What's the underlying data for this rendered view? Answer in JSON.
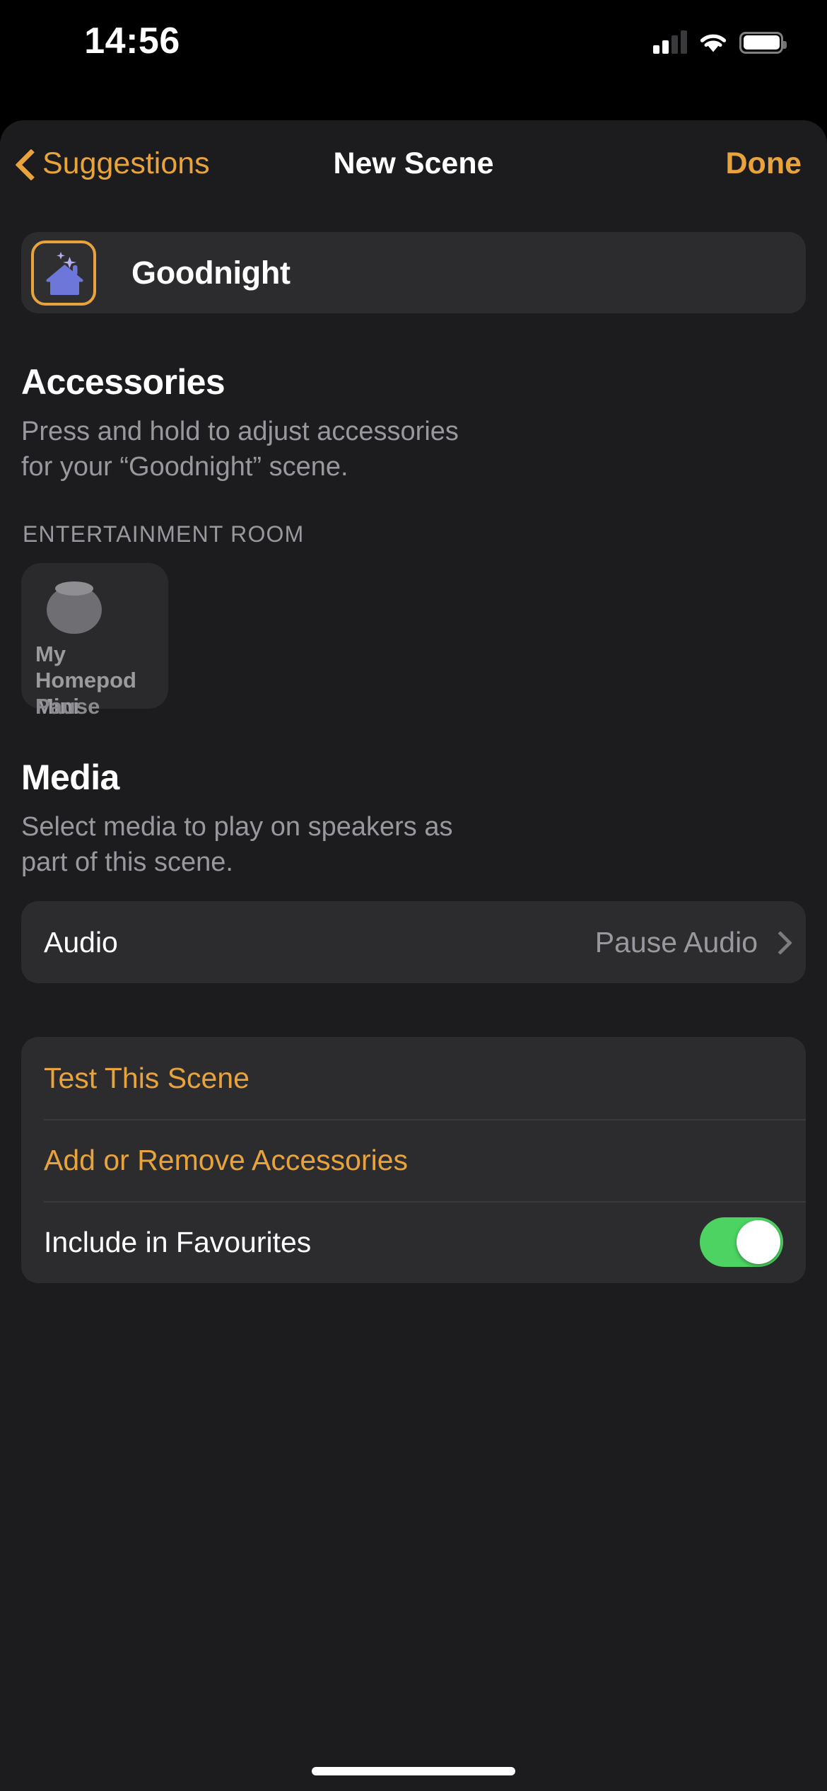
{
  "status_bar": {
    "time": "14:56",
    "cellular_icon": "cellular-signal-icon",
    "cellular_bars_active": 2,
    "cellular_bars_total": 4,
    "wifi_icon": "wifi-icon",
    "battery_icon": "battery-icon",
    "battery_level_percent": 92
  },
  "nav_bar": {
    "back_label": "Suggestions",
    "back_icon": "chevron-left-icon",
    "title": "New Scene",
    "done_label": "Done"
  },
  "scene": {
    "name": "Goodnight",
    "icon": "moon-stars-house-icon",
    "icon_border_color": "#E8A33D",
    "icon_moon_color": "#B7B0F0",
    "icon_house_color": "#6C77D9"
  },
  "accessories_section": {
    "title": "Accessories",
    "description": "Press and hold to adjust accessories for your “Goodnight” scene.",
    "room_label": "ENTERTAINMENT ROOM",
    "tiles": [
      {
        "name": "My Homepod Mini",
        "state": "Pause",
        "icon": "homepod-mini-icon"
      }
    ]
  },
  "media_section": {
    "title": "Media",
    "description": "Select media to play on speakers as part of this scene.",
    "rows": [
      {
        "label": "Audio",
        "value": "Pause Audio",
        "chevron_icon": "chevron-right-icon"
      }
    ]
  },
  "actions": {
    "test_scene_label": "Test This Scene",
    "add_remove_label": "Add or Remove Accessories",
    "favourites_label": "Include in Favourites",
    "favourites_toggle_on": true,
    "toggle_on_color": "#4CD362"
  },
  "colors": {
    "accent_orange": "#E8A33D",
    "sheet_background": "#1C1C1E",
    "card_background": "#2C2C2E",
    "secondary_text": "#98989E"
  }
}
